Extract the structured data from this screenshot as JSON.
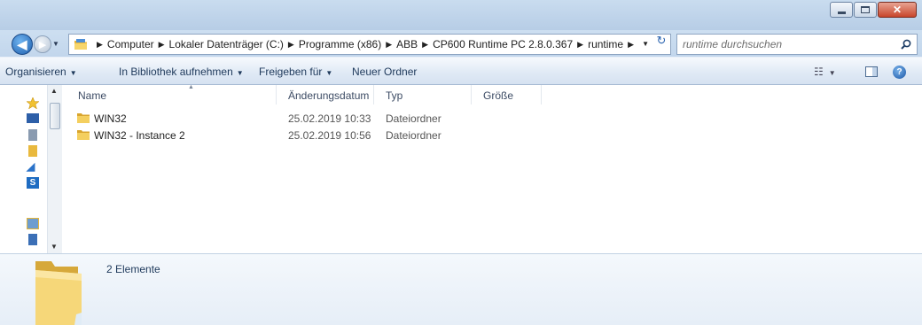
{
  "colors": {
    "titlebar": "#c9dcef",
    "toolbar_text": "#1e395b",
    "close_button": "#c8452b",
    "folder": "#f0c94e"
  },
  "address": {
    "crumbs": [
      "Computer",
      "Lokaler Datenträger (C:)",
      "Programme (x86)",
      "ABB",
      "CP600 Runtime PC 2.8.0.367",
      "runtime"
    ]
  },
  "search": {
    "placeholder": "runtime durchsuchen"
  },
  "toolbar": {
    "organize": "Organisieren",
    "include_library": "In Bibliothek aufnehmen",
    "share_with": "Freigeben für",
    "new_folder": "Neuer Ordner"
  },
  "columns": {
    "name": "Name",
    "modified": "Änderungsdatum",
    "type": "Typ",
    "size": "Größe"
  },
  "files": [
    {
      "name": "WIN32",
      "modified": "25.02.2019 10:33",
      "type": "Dateiordner",
      "size": ""
    },
    {
      "name": "WIN32 - Instance 2",
      "modified": "25.02.2019 10:56",
      "type": "Dateiordner",
      "size": ""
    }
  ],
  "details": {
    "count": "2 Elemente"
  },
  "icons": [
    "back-arrow-icon",
    "forward-arrow-icon",
    "folder-icon",
    "refresh-icon",
    "search-icon",
    "star-icon",
    "help-icon",
    "view-icon",
    "preview-pane-icon"
  ]
}
